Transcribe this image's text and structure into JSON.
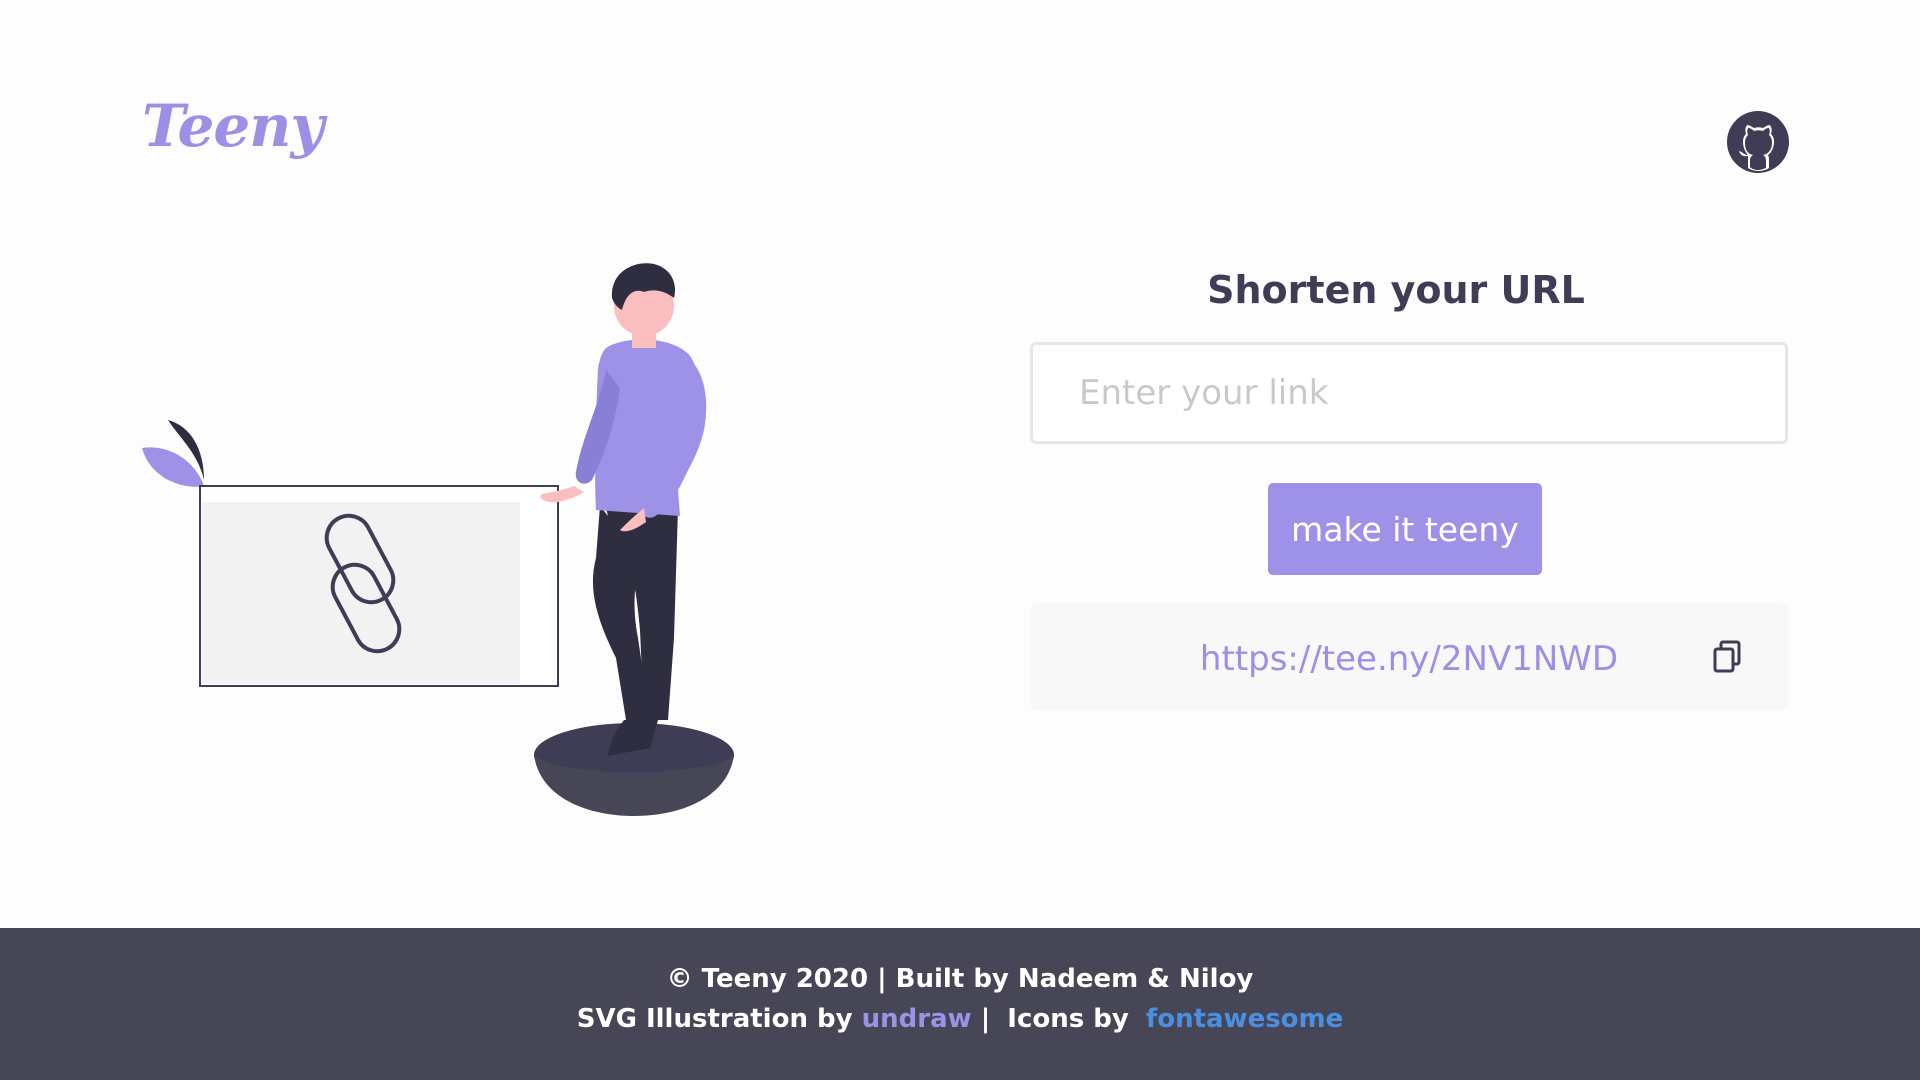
{
  "header": {
    "logo_text": "Teeny",
    "github_icon": "github-icon"
  },
  "form": {
    "title": "Shorten your URL",
    "input_placeholder": "Enter your link",
    "input_value": "",
    "button_label": "make it teeny"
  },
  "result": {
    "short_url": "https://tee.ny/2NV1NWD",
    "copy_icon": "copy-icon"
  },
  "footer": {
    "line1": "© Teeny 2020 | Built by Nadeem & Niloy",
    "svg_prefix": "SVG Illustration by ",
    "undraw_label": "undraw",
    "separator": "|",
    "icons_prefix": "Icons by",
    "fontawesome_label": "fontawesome"
  },
  "colors": {
    "accent": "#9e92e8",
    "dark": "#3f3d56",
    "footer_bg": "#474656",
    "link_blue": "#4a90e2"
  }
}
